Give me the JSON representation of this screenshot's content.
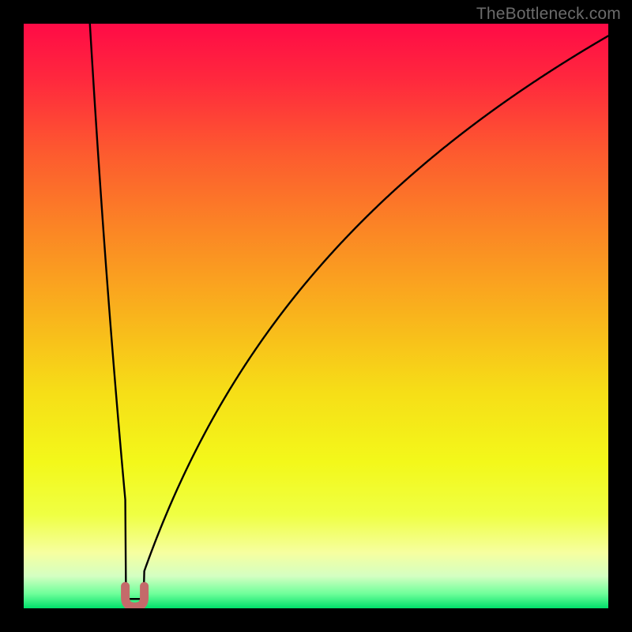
{
  "attribution": "TheBottleneck.com",
  "chart_data": {
    "type": "line",
    "title": "",
    "xlabel": "",
    "ylabel": "",
    "xlim": [
      0,
      100
    ],
    "ylim": [
      0,
      100
    ],
    "notes": "Bottleneck-style curve. y ≈ 100 * | log(x / x0) / log(xMax / x0) | with a small flat bottom around x0. Gradient background red→green top→bottom.",
    "params": {
      "x0": 19,
      "flat_half_width": 1.6,
      "bottom_y": 1.6,
      "left_amp": 190,
      "right_amp": 58
    },
    "marker": {
      "x": 19,
      "y": 1.6,
      "shape": "u",
      "color": "#c46a6a",
      "stroke_width": 11
    },
    "gradient_stops": [
      {
        "offset": 0.0,
        "color": "#ff0b46"
      },
      {
        "offset": 0.1,
        "color": "#ff2a3d"
      },
      {
        "offset": 0.22,
        "color": "#fd5a2f"
      },
      {
        "offset": 0.35,
        "color": "#fb8525"
      },
      {
        "offset": 0.5,
        "color": "#f9b41c"
      },
      {
        "offset": 0.63,
        "color": "#f6de17"
      },
      {
        "offset": 0.75,
        "color": "#f3f81a"
      },
      {
        "offset": 0.84,
        "color": "#efff43"
      },
      {
        "offset": 0.905,
        "color": "#f6ffa0"
      },
      {
        "offset": 0.945,
        "color": "#d4ffc2"
      },
      {
        "offset": 0.975,
        "color": "#6fff9a"
      },
      {
        "offset": 1.0,
        "color": "#00e06a"
      }
    ],
    "series": [
      {
        "name": "bottleneck-curve",
        "color": "#000000",
        "stroke_width": 2.4,
        "x": [
          5.5,
          6,
          7,
          8,
          9,
          10,
          11,
          12,
          13,
          14,
          15,
          16,
          17,
          17.4,
          18,
          18.5,
          19,
          19.5,
          20,
          20.6,
          21.5,
          23,
          25,
          28,
          31,
          35,
          40,
          45,
          50,
          56,
          63,
          70,
          78,
          86,
          94,
          100
        ],
        "y": [
          100,
          94.3,
          80.8,
          69.4,
          59.5,
          50.8,
          43.0,
          35.9,
          29.4,
          23.4,
          17.9,
          12.7,
          7.8,
          5.9,
          3.1,
          1.6,
          1.6,
          1.6,
          3.1,
          5.9,
          8.9,
          13.5,
          18.2,
          24.1,
          29.2,
          34.9,
          40.8,
          45.7,
          49.9,
          54.3,
          58.8,
          62.6,
          66.4,
          69.8,
          72.9,
          75.0
        ]
      }
    ]
  }
}
